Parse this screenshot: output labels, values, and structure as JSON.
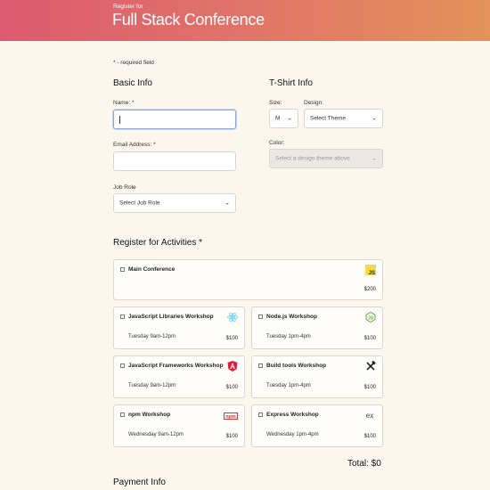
{
  "header": {
    "subtitle": "Register for",
    "title": "Full Stack Conference"
  },
  "required_note": "* - required field",
  "basic_info": {
    "heading": "Basic Info",
    "name_label": "Name: *",
    "name_value": "",
    "email_label": "Email Address: *",
    "email_value": "",
    "job_role_label": "Job Role",
    "job_role_selected": "Select Job Role"
  },
  "tshirt": {
    "heading": "T-Shirt Info",
    "size_label": "Size:",
    "size_selected": "M",
    "design_label": "Design:",
    "design_selected": "Select Theme",
    "color_label": "Color:",
    "color_selected": "Select a design theme above"
  },
  "activities": {
    "heading": "Register for Activities *",
    "items": [
      {
        "name": "Main Conference",
        "time": "",
        "price": "$200",
        "icon": "javascript-icon"
      },
      {
        "name": "JavaScript Libraries Workshop",
        "time": "Tuesday 9am-12pm",
        "price": "$100",
        "icon": "react-icon"
      },
      {
        "name": "Node.js Workshop",
        "time": "Tuesday 1pm-4pm",
        "price": "$100",
        "icon": "nodejs-icon"
      },
      {
        "name": "JavaScript Frameworks Workshop",
        "time": "Tuesday 9am-12pm",
        "price": "$100",
        "icon": "angular-icon"
      },
      {
        "name": "Build tools Workshop",
        "time": "Tuesday 1pm-4pm",
        "price": "$100",
        "icon": "tools-icon"
      },
      {
        "name": "npm Workshop",
        "time": "Wednesday 9am-12pm",
        "price": "$100",
        "icon": "npm-icon"
      },
      {
        "name": "Express Workshop",
        "time": "Wednesday 1pm-4pm",
        "price": "$100",
        "icon": "express-icon"
      }
    ],
    "total": "Total: $0"
  },
  "payment": {
    "heading": "Payment Info"
  }
}
